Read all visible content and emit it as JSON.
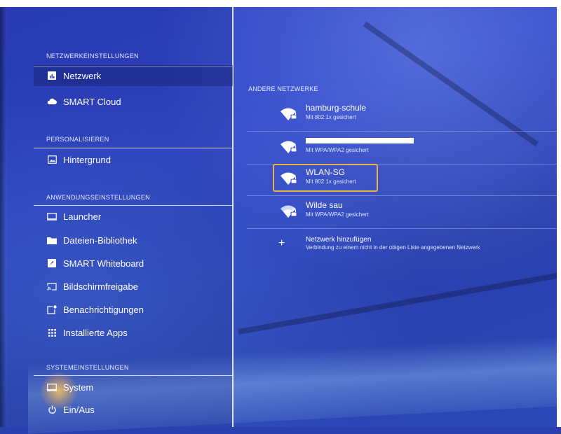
{
  "sidebar": {
    "sections": [
      {
        "header": "NETZWERKEINSTELLUNGEN",
        "items": [
          {
            "label": "Netzwerk",
            "icon": "network-icon",
            "selected": true
          },
          {
            "label": "SMART Cloud",
            "icon": "cloud-icon"
          }
        ]
      },
      {
        "header": "PERSONALISIEREN",
        "items": [
          {
            "label": "Hintergrund",
            "icon": "wallpaper-icon"
          }
        ]
      },
      {
        "header": "ANWENDUNGSEINSTELLUNGEN",
        "items": [
          {
            "label": "Launcher",
            "icon": "launcher-icon"
          },
          {
            "label": "Dateien-Bibliothek",
            "icon": "folder-icon"
          },
          {
            "label": "SMART Whiteboard",
            "icon": "whiteboard-icon"
          },
          {
            "label": "Bildschirmfreigabe",
            "icon": "screen-share-icon"
          },
          {
            "label": "Benachrichtigungen",
            "icon": "notification-icon"
          },
          {
            "label": "Installierte Apps",
            "icon": "apps-grid-icon"
          }
        ]
      },
      {
        "header": "SYSTEMEINSTELLUNGEN",
        "items": [
          {
            "label": "System",
            "icon": "system-icon"
          },
          {
            "label": "Ein/Aus",
            "icon": "power-icon"
          }
        ]
      }
    ]
  },
  "main": {
    "header": "ANDERE NETZWERKE",
    "networks": [
      {
        "name": "hamburg-schule",
        "security": "Mit 802.1x gesichert"
      },
      {
        "name": "",
        "security": "Mit WPA/WPA2 gesichert",
        "name_redacted": true
      },
      {
        "name": "WLAN-SG",
        "security": "Mit 802.1x gesichert",
        "focused": true
      },
      {
        "name": "Wilde sau",
        "security": "Mit WPA/WPA2 gesichert"
      }
    ],
    "add_network": {
      "icon": "plus-icon",
      "title": "Netzwerk hinzufügen",
      "subtitle": "Verbindung zu einem nicht in der obigen Liste angegebenen Netzwerk"
    }
  },
  "colors": {
    "background": "#2c3fc0",
    "focus_border": "#e8b63e",
    "text": "#ffffff"
  }
}
